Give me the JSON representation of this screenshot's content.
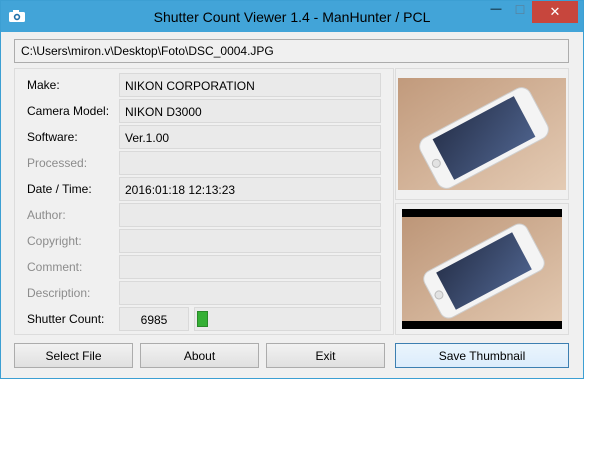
{
  "window": {
    "title": "Shutter Count Viewer 1.4 - ManHunter / PCL",
    "minimize_glyph": "—",
    "maximize_glyph": "☐",
    "close_glyph": "✕",
    "accent": "#42a4d8",
    "close_color": "#c7463d"
  },
  "file_path": "C:\\Users\\miron.v\\Desktop\\Foto\\DSC_0004.JPG",
  "fields": [
    {
      "label": "Make:",
      "value": "NIKON CORPORATION",
      "enabled": true
    },
    {
      "label": "Camera Model:",
      "value": "NIKON D3000",
      "enabled": true
    },
    {
      "label": "Software:",
      "value": "Ver.1.00",
      "enabled": true
    },
    {
      "label": "Processed:",
      "value": "",
      "enabled": false
    },
    {
      "label": "Date / Time:",
      "value": "2016:01:18 12:13:23",
      "enabled": true
    },
    {
      "label": "Author:",
      "value": "",
      "enabled": false
    },
    {
      "label": "Copyright:",
      "value": "",
      "enabled": false
    },
    {
      "label": "Comment:",
      "value": "",
      "enabled": false
    },
    {
      "label": "Description:",
      "value": "",
      "enabled": false
    }
  ],
  "shutter": {
    "label": "Shutter Count:",
    "value": "6985",
    "bar_fraction": 0.06,
    "bar_color": "#35b035"
  },
  "thumbnails": {
    "large_icon": "photo-iphone-on-table",
    "embedded_icon": "embedded-thumbnail-iphone"
  },
  "buttons": {
    "select_file": "Select File",
    "about": "About",
    "exit": "Exit",
    "save_thumbnail": "Save Thumbnail"
  }
}
